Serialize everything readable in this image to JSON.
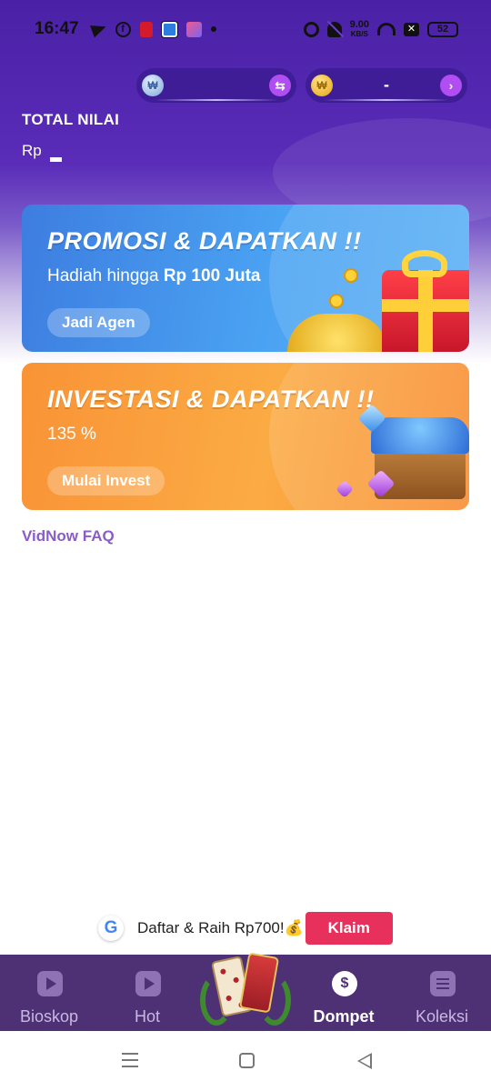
{
  "status_bar": {
    "time": "16:47",
    "network_speed_value": "9.00",
    "network_speed_unit": "KB/S",
    "battery": "52",
    "icons": [
      "telegram-icon",
      "facebook-icon",
      "notification-icon",
      "browser-icon",
      "app-icon",
      "dot-icon",
      "alarm-icon",
      "mute-icon",
      "wifi-icon",
      "sim-off-icon",
      "battery-icon"
    ]
  },
  "wallet": {
    "balance_pills": [
      {
        "coin_icon": "silver-coin-icon",
        "value": "",
        "action_icon": "swap-icon"
      },
      {
        "coin_icon": "gold-coin-icon",
        "value": "-",
        "action_icon": "chevron-right-icon"
      }
    ],
    "total_label": "TOTAL NILAI",
    "currency_label": "Rp"
  },
  "banners": {
    "promo": {
      "title": "PROMOSI & DAPATKAN !!",
      "subtitle_prefix": "Hadiah hingga ",
      "subtitle_bold": "Rp 100 Juta",
      "button": "Jadi Agen"
    },
    "invest": {
      "title": "INVESTASI & DAPATKAN !!",
      "subtitle": "135 %",
      "button": "Mulai Invest"
    }
  },
  "faq_link": "VidNow FAQ",
  "ad_bar": {
    "text": "Daftar & Raih Rp700!💰",
    "button": "Klaim"
  },
  "bottom_nav": {
    "active": "Dompet",
    "items": [
      {
        "label": "Bioskop",
        "icon": "play-icon"
      },
      {
        "label": "Hot",
        "icon": "video-icon"
      },
      {
        "label": "",
        "icon": "domino-game-icon"
      },
      {
        "label": "Dompet",
        "icon": "dollar-icon"
      },
      {
        "label": "Koleksi",
        "icon": "collection-icon"
      }
    ]
  },
  "colors": {
    "hero_purple": "#4a21a6",
    "nav_bg": "#4e3075",
    "promo_blue": "#3d7de0",
    "invest_orange": "#f99336",
    "faq_purple": "#8a5cc7",
    "claim_pink": "#e8305d"
  }
}
